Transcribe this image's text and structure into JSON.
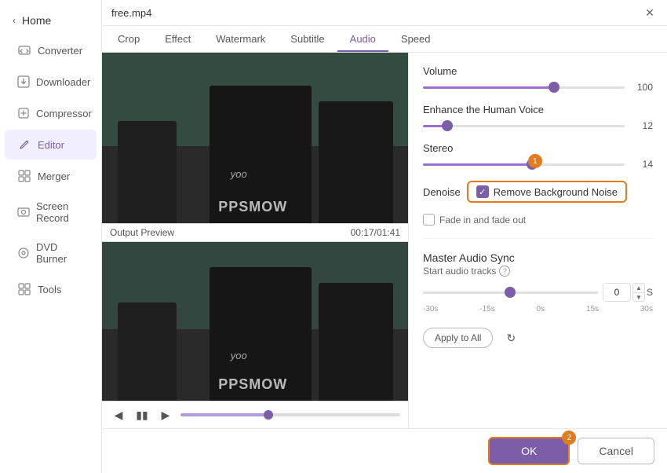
{
  "titleBar": {
    "filename": "free.mp4",
    "closeLabel": "✕"
  },
  "tabs": [
    {
      "id": "crop",
      "label": "Crop"
    },
    {
      "id": "effect",
      "label": "Effect"
    },
    {
      "id": "watermark",
      "label": "Watermark"
    },
    {
      "id": "subtitle",
      "label": "Subtitle"
    },
    {
      "id": "audio",
      "label": "Audio",
      "active": true
    },
    {
      "id": "speed",
      "label": "Speed"
    }
  ],
  "sidebar": {
    "homeLabel": "Home",
    "items": [
      {
        "id": "converter",
        "label": "Converter",
        "icon": "⬇"
      },
      {
        "id": "downloader",
        "label": "Downloader",
        "icon": "⬇"
      },
      {
        "id": "compressor",
        "label": "Compressor",
        "icon": "◈"
      },
      {
        "id": "editor",
        "label": "Editor",
        "icon": "✂",
        "active": true
      },
      {
        "id": "merger",
        "label": "Merger",
        "icon": "⊞"
      },
      {
        "id": "screen-record",
        "label": "Screen Record",
        "icon": "⊡"
      },
      {
        "id": "dvd-burner",
        "label": "DVD Burner",
        "icon": "⊙"
      },
      {
        "id": "tools",
        "label": "Tools",
        "icon": "⊞"
      }
    ]
  },
  "audioPanel": {
    "volumeLabel": "Volume",
    "volumeValue": "100",
    "volumePercent": 65,
    "enhanceLabel": "Enhance the Human Voice",
    "enhanceValue": "12",
    "enhancePercent": 12,
    "stereoLabel": "Stereo",
    "stereoValue": "14",
    "stereoPercent": 54,
    "stereoBadge": "1",
    "denoiseLabel": "Denoise",
    "removeNoiseLabel": "Remove Background Noise",
    "fadeLabel": "Fade in and fade out",
    "masterSyncTitle": "Master Audio Sync",
    "masterSyncSubtitle": "Start audio tracks",
    "syncValue": "0",
    "syncLabels": [
      "-30s",
      "-15s",
      "0s",
      "15s",
      "30s"
    ],
    "applyAllLabel": "Apply to All",
    "okLabel": "OK",
    "okBadge": "2",
    "cancelLabel": "Cancel"
  },
  "player": {
    "outputLabel": "Output Preview",
    "timestamp": "00:17/01:41"
  }
}
